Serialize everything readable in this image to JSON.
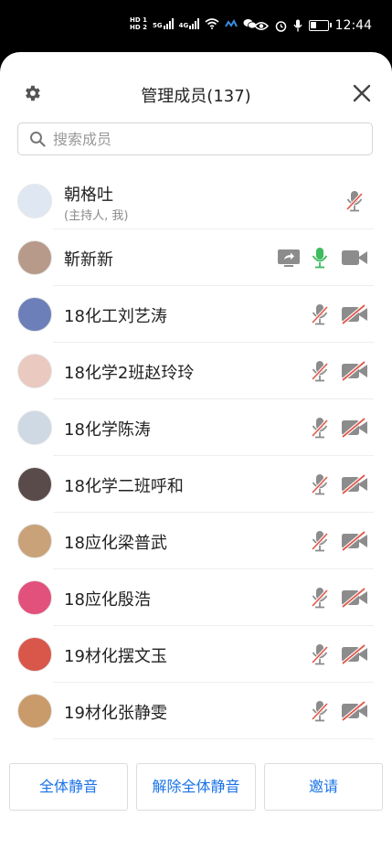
{
  "status_bar": {
    "hd_1": "HD 1",
    "hd_2": "HD 2",
    "net_1": "5G",
    "net_2": "4G",
    "time": "12:44"
  },
  "header": {
    "title": "管理成员(137)",
    "settings_icon": "gear-icon",
    "close_icon": "close-icon"
  },
  "search": {
    "placeholder": "搜索成员"
  },
  "members": [
    {
      "name": "朝格吐",
      "sub": "(主持人, 我)",
      "avatar_color": "#dfe8f2",
      "mic": "muted",
      "camera": "none",
      "share": false
    },
    {
      "name": "靳新新",
      "avatar_color": "#b89a8a",
      "mic": "on",
      "camera": "on",
      "share": true
    },
    {
      "name": "18化工刘艺涛",
      "avatar_color": "#6d7fb8",
      "mic": "muted",
      "camera": "off",
      "share": false
    },
    {
      "name": "18化学2班赵玲玲",
      "avatar_color": "#e9c9c0",
      "mic": "muted",
      "camera": "off",
      "share": false
    },
    {
      "name": "18化学陈涛",
      "avatar_color": "#cfd9e3",
      "mic": "muted",
      "camera": "off",
      "share": false
    },
    {
      "name": "18化学二班呼和",
      "avatar_color": "#5a4b4b",
      "mic": "muted",
      "camera": "off",
      "share": false
    },
    {
      "name": "18应化梁普武",
      "avatar_color": "#c9a27a",
      "mic": "muted",
      "camera": "off",
      "share": false
    },
    {
      "name": "18应化殷浩",
      "avatar_color": "#e2507c",
      "mic": "muted",
      "camera": "off",
      "share": false
    },
    {
      "name": "19材化摆文玉",
      "avatar_color": "#d8574a",
      "mic": "muted",
      "camera": "off",
      "share": false
    },
    {
      "name": "19材化张静雯",
      "avatar_color": "#c99a6a",
      "mic": "muted",
      "camera": "off",
      "share": false
    }
  ],
  "footer": {
    "mute_all": "全体静音",
    "unmute_all": "解除全体静音",
    "invite": "邀请"
  },
  "colors": {
    "accent": "#1a73e8",
    "mic_on": "#3dbb5d",
    "muted": "#e0564a",
    "icon_gray": "#8c8c8c"
  }
}
